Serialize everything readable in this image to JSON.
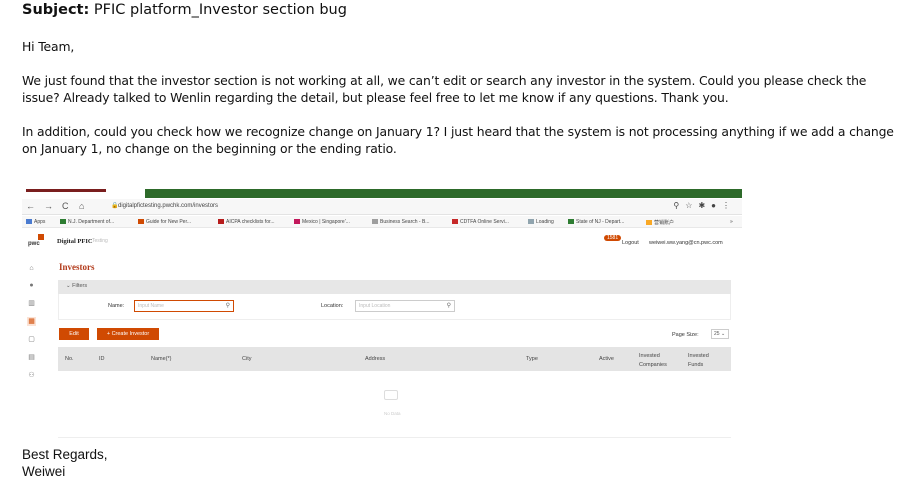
{
  "email": {
    "subject_label": "Subject:",
    "subject_text": " PFIC platform_Investor section bug",
    "greeting": "Hi Team,",
    "paragraph1": "We just found that the investor section is not working at all, we can’t edit or search any investor in the system. Could you please check the issue? Already talked to Wenlin regarding the detail, but please feel free to let me know if any questions. Thank you.",
    "paragraph2": "In addition, could you check how we recognize change on January 1? I just heard that the system is not processing anything if we add a change on January 1, no change on the beginning or the ending ratio.",
    "closing": "Best Regards,",
    "signature": "Weiwei"
  },
  "browser": {
    "tab_text": "Digital PFIC Testing",
    "url": "digitalpfictesting.pwchk.com/investors",
    "bookmarks": [
      "Apps",
      "N.J. Department of...",
      "Guide for New Per...",
      "AICPA checklists for...",
      "Mexico | Singapore'...",
      "Business Search - B...",
      "CDTFA Online Servi...",
      "Loading",
      "State of NJ - Depart...",
      "营销账户"
    ],
    "bookmarks_more": "»"
  },
  "app": {
    "logo_text": "pwc",
    "title": "Digital PFIC",
    "title_suffix": "Testing",
    "notification_count": "1581",
    "logout": "Logout",
    "user_email": "weiwei.ww.yang@cn.pwc.com",
    "page_title": "Investors",
    "filters_label": "Filters",
    "name_label": "Name:",
    "name_placeholder": "Input Name",
    "location_label": "Location:",
    "location_placeholder": "Input Location",
    "edit_button": "Edit",
    "create_button": "+ Create Investor",
    "page_size_label": "Page Size:",
    "page_size_value": "25",
    "columns": [
      "No.",
      "ID",
      "Name(*)",
      "City",
      "Address",
      "Type",
      "Active",
      "Invested Companies",
      "Invested Funds"
    ],
    "empty_text": "No Data"
  },
  "colors": {
    "accent": "#d04a02",
    "title_red": "#b23a1a"
  }
}
